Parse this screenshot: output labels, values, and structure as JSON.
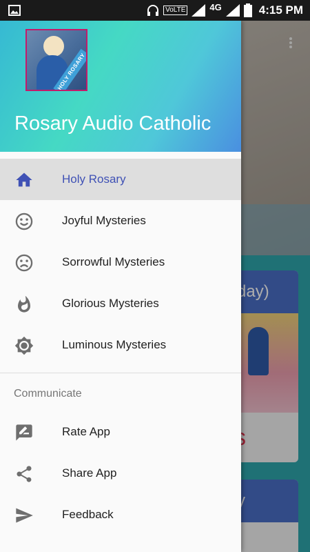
{
  "status_bar": {
    "time": "4:15 PM",
    "volte": "VoLTE",
    "network": "4G",
    "icons": [
      "image-icon",
      "headphones-icon",
      "signal-icon",
      "battery-icon"
    ]
  },
  "drawer": {
    "app_title": "Rosary Audio Catholic",
    "header_image_ribbon": "HOLY ROSARY",
    "menu": [
      {
        "label": "Holy Rosary",
        "icon": "home-icon",
        "selected": true
      },
      {
        "label": "Joyful Mysteries",
        "icon": "smile-icon",
        "selected": false
      },
      {
        "label": "Sorrowful Mysteries",
        "icon": "sad-face-icon",
        "selected": false
      },
      {
        "label": "Glorious Mysteries",
        "icon": "flame-icon",
        "selected": false
      },
      {
        "label": "Luminous Mysteries",
        "icon": "brightness-icon",
        "selected": false
      }
    ],
    "section_title": "Communicate",
    "communicate": [
      {
        "label": "Rate App",
        "icon": "rate-review-icon"
      },
      {
        "label": "Share App",
        "icon": "share-icon"
      },
      {
        "label": "Feedback",
        "icon": "send-icon"
      }
    ]
  },
  "background": {
    "card1_title": "day)",
    "card2_title": "y",
    "card1_footer": "s"
  },
  "colors": {
    "accent": "#3f51b5",
    "selected_bg": "#dedede",
    "header_gradient_start": "#36b9d3",
    "header_gradient_end": "#4a8fe0"
  }
}
